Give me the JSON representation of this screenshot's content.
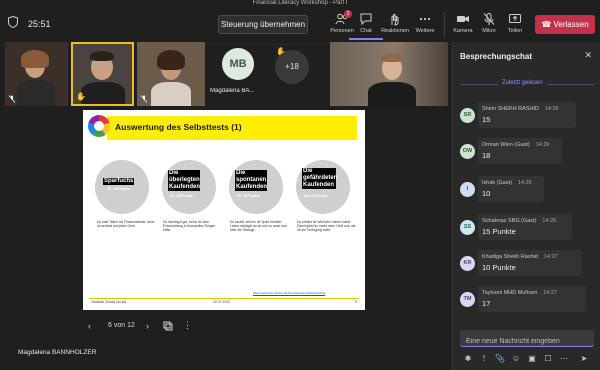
{
  "window": {
    "title": "Financial Literacy Workshop - Part I"
  },
  "header": {
    "time": "25:51",
    "control_button": "Steuerung übernehmen",
    "items": [
      {
        "label": "Personen",
        "icon": "people-icon",
        "badge": "2"
      },
      {
        "label": "Chat",
        "icon": "chat-icon"
      },
      {
        "label": "Reaktionen",
        "icon": "reactions-icon"
      },
      {
        "label": "Weitere",
        "icon": "more-icon"
      },
      {
        "label": "Kamera",
        "icon": "camera-icon"
      },
      {
        "label": "Mikro",
        "icon": "mic-icon"
      },
      {
        "label": "Teilen",
        "icon": "share-icon"
      }
    ],
    "leave_label": "Verlassen"
  },
  "participants": {
    "tile_mb_initials": "MB",
    "tile_mb_name": "Magdalena BA...",
    "overflow_count": "+18"
  },
  "slide": {
    "title": "Auswertung des Selbsttests (1)",
    "circles": [
      {
        "label": "Sparfuchs",
        "points": "40 - 25 Punkte",
        "desc": "Du hast Talent als Finanzminister, denn du achtest auf jeden Cent."
      },
      {
        "label": "Die überlegten Kaufenden",
        "points": "11 - 18 Punkte",
        "desc": "Du überlegst gut, bevor du eine Entscheidung in finanziellen Dingen triffst."
      },
      {
        "label": "Die spontanen Kaufenden",
        "points": "25 - 94 Punkte",
        "desc": "Du kaufst, weil es dir Spaß bereitet. Leider schlägst du ab und zu auch mal über die Stränge."
      },
      {
        "label": "Die gefährdeten Kaufenden",
        "points": "über 34 Punkte",
        "desc": "Du erfüllst dir Wünsche immer sofort. Damit gibst du meist mehr Geld aus, als dir zur Verfügung steht."
      }
    ],
    "link": "https://www.lfun-finanz.de/finanzwissen/selbsttest.html",
    "footer_left": "Victorian Zusatz bei auf",
    "footer_mid": "22.07.2022",
    "footer_right": "9"
  },
  "slide_nav": {
    "counter": "6 von 12",
    "prev": "‹",
    "next": "›"
  },
  "presenter_name": "Magdalena BANNHOLZER",
  "chat": {
    "title": "Besprechungschat",
    "read_label": "Zuletzt gelesen",
    "messages": [
      {
        "initials": "SR",
        "avatar_bg": "#cfe3d0",
        "avatar_fg": "#2f5a37",
        "name": "Shirin SHEKH RASHID",
        "time": "14:26",
        "text": "15"
      },
      {
        "initials": "OW",
        "avatar_bg": "#cfe3d0",
        "avatar_fg": "#2f5a37",
        "name": "Omran Wien (Gast)",
        "time": "14:26",
        "text": "18"
      },
      {
        "initials": "I",
        "avatar_bg": "#d4dcef",
        "avatar_fg": "#36457a",
        "name": "Ishak (Gast)",
        "time": "14:26",
        "text": "10"
      },
      {
        "initials": "SS",
        "avatar_bg": "#cfe6ec",
        "avatar_fg": "#2b5d6b",
        "name": "Schabnaz SBG (Gast)",
        "time": "14:26",
        "text": "15 Punkte"
      },
      {
        "initials": "KR",
        "avatar_bg": "#dad8ef",
        "avatar_fg": "#45407a",
        "name": "Khadiga Shekh Rashid",
        "time": "14:27",
        "text": "10 Punkte"
      },
      {
        "initials": "TM",
        "avatar_bg": "#dad8ef",
        "avatar_fg": "#45407a",
        "name": "Tayluoni MHD Mulham",
        "time": "14:27",
        "text": "17"
      }
    ],
    "compose_placeholder": "Eine neue Nachricht eingeben"
  },
  "colors": {
    "accent": "#7f85f5",
    "leave": "#c4314b",
    "slide_yellow": "#ffee00",
    "raised_hand": "#f5c542"
  }
}
